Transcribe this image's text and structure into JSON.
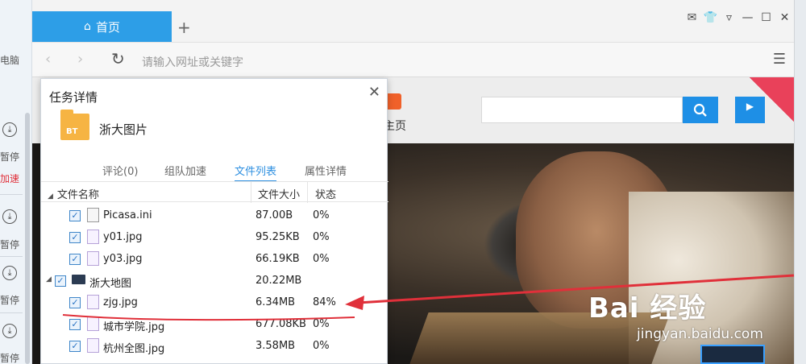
{
  "left_panel": {
    "items": [
      {
        "label": "电脑"
      },
      {
        "label": "暂停"
      },
      {
        "label": "加速"
      },
      {
        "label": "暂停"
      },
      {
        "label": "暂停"
      },
      {
        "label": "暂停"
      }
    ]
  },
  "browser": {
    "tab": {
      "label": "首页"
    },
    "new_tab_label": "+",
    "address": {
      "placeholder": "请输入网址或关键字"
    },
    "window_controls": [
      "mail-icon",
      "skin-icon",
      "dropdown-icon",
      "minimize-icon",
      "maximize-icon",
      "close-icon"
    ]
  },
  "page": {
    "home_link": "主页",
    "watermark": "Bai 经验",
    "watermark_url": "jingyan.baidu.com"
  },
  "panel": {
    "title": "任务详情",
    "folder_badge": "BT",
    "task_name": "浙大图片",
    "tabs": [
      {
        "label": "评论(0)"
      },
      {
        "label": "组队加速"
      },
      {
        "label": "文件列表",
        "active": true
      },
      {
        "label": "属性详情"
      }
    ],
    "columns": {
      "name": "文件名称",
      "size": "文件大小",
      "status": "状态"
    },
    "rows": [
      {
        "name": "Picasa.ini",
        "size": "87.00B",
        "status": "0%",
        "type": "doc"
      },
      {
        "name": "y01.jpg",
        "size": "95.25KB",
        "status": "0%",
        "type": "image"
      },
      {
        "name": "y03.jpg",
        "size": "66.19KB",
        "status": "0%",
        "type": "image"
      },
      {
        "name": "浙大地图",
        "size": "20.22MB",
        "status": "",
        "type": "folder"
      },
      {
        "name": "zjg.jpg",
        "size": "6.34MB",
        "status": "84%",
        "type": "image"
      },
      {
        "name": "城市学院.jpg",
        "size": "677.08KB",
        "status": "0%",
        "type": "image"
      },
      {
        "name": "杭州全图.jpg",
        "size": "3.58MB",
        "status": "0%",
        "type": "image"
      }
    ]
  },
  "colors": {
    "accent": "#2d9ee7",
    "annotation": "#e0303a",
    "folder": "#f6b443"
  }
}
